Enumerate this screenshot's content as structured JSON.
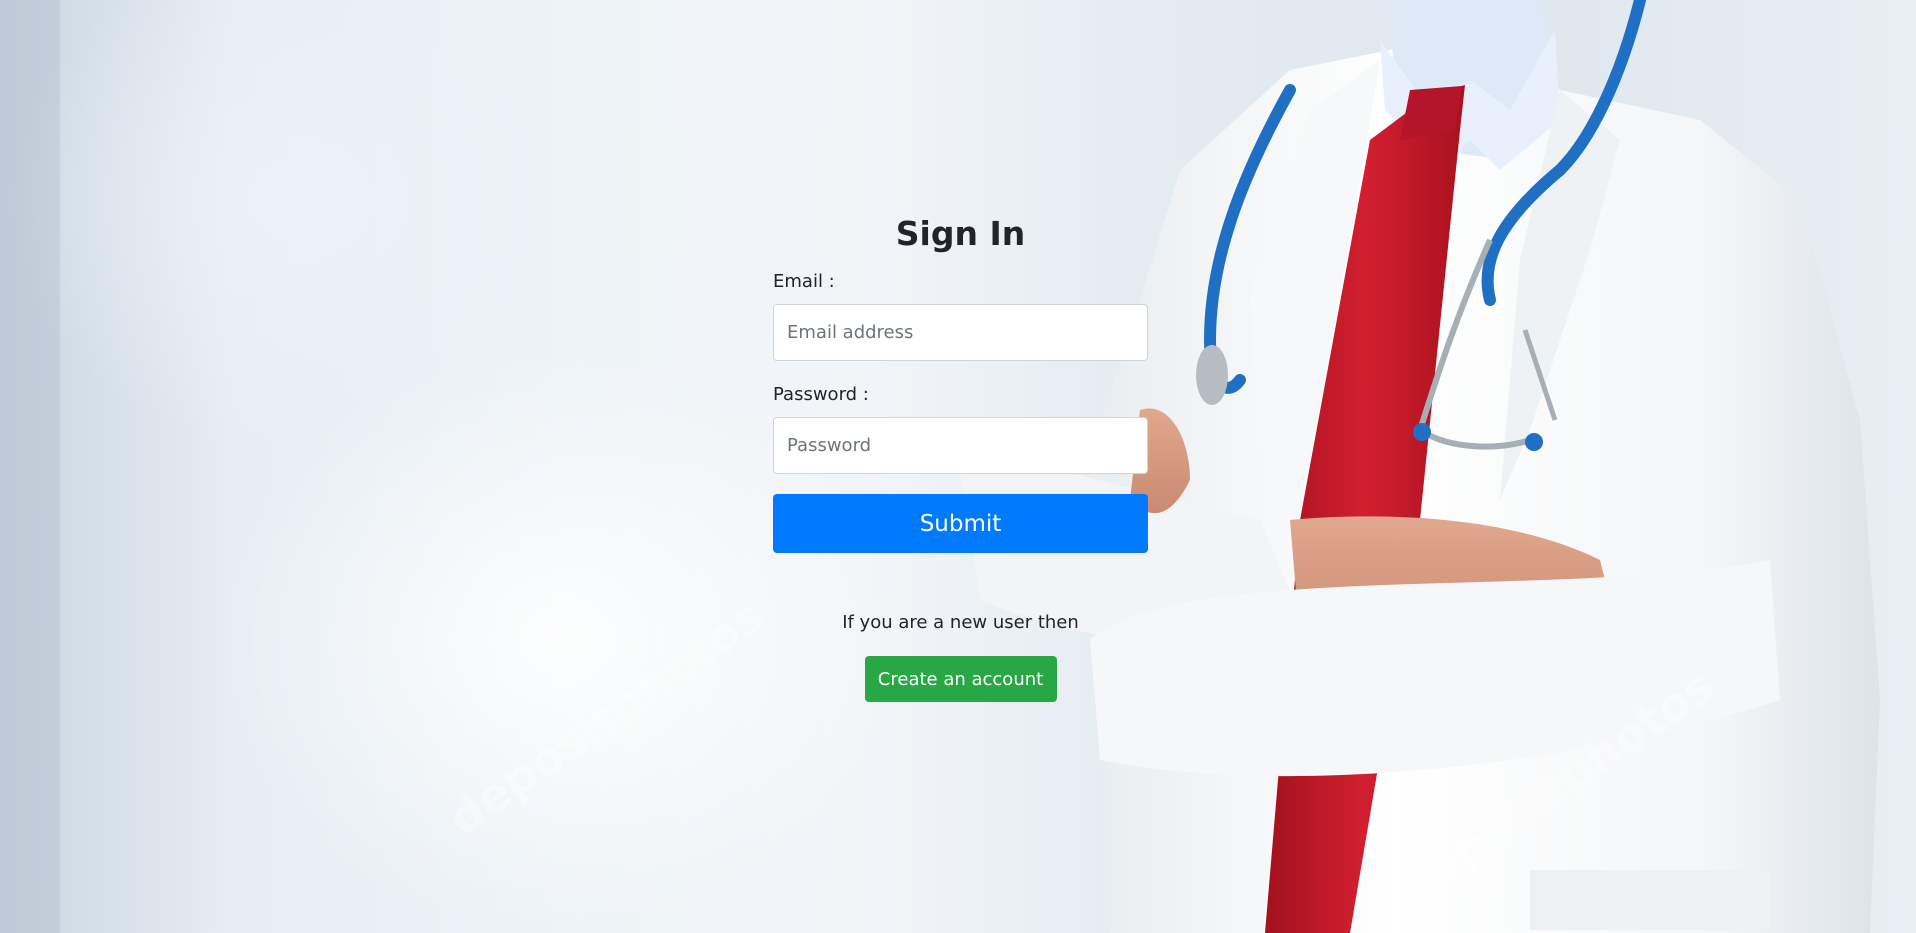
{
  "signin": {
    "title": "Sign In",
    "email_label": "Email :",
    "email_placeholder": "Email address",
    "email_value": "",
    "password_label": "Password :",
    "password_placeholder": "Password",
    "password_value": "",
    "submit_label": "Submit"
  },
  "signup": {
    "prompt": "If you are a new user then",
    "create_label": "Create an account"
  },
  "background": {
    "watermark_text": "depositphotos",
    "subject": "doctor-with-stethoscope",
    "primary_color": "#007bff",
    "success_color": "#28a745"
  }
}
